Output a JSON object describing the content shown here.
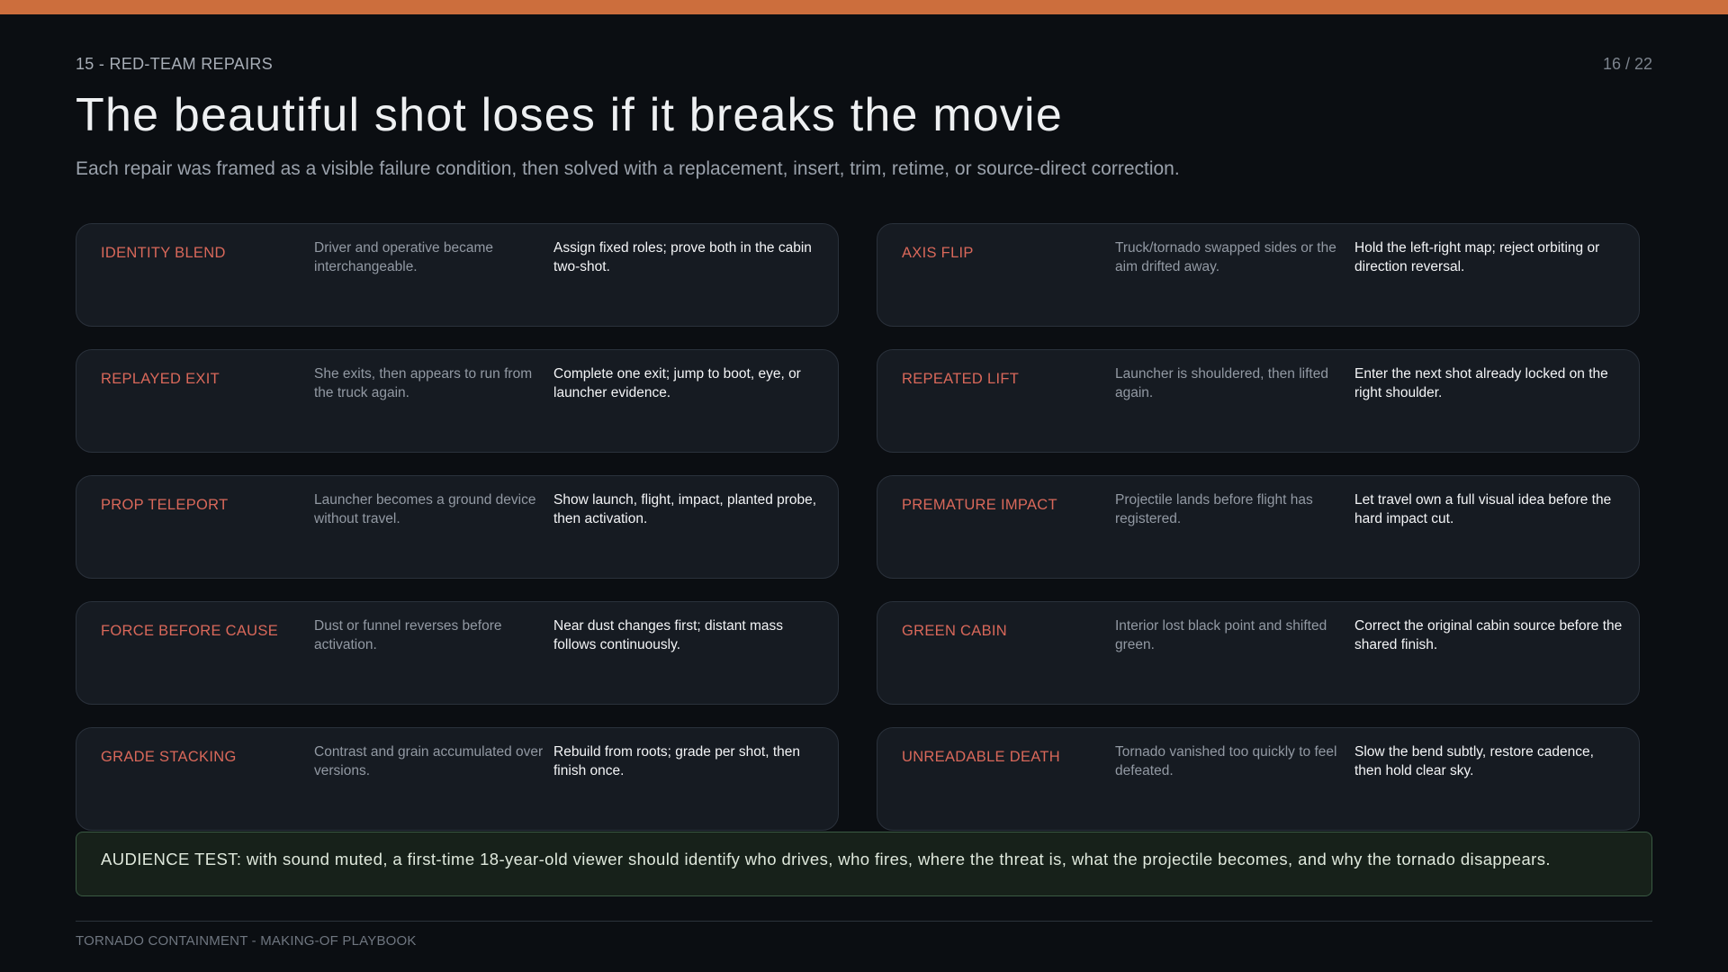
{
  "slide": {
    "section": "15 - RED-TEAM REPAIRS",
    "page_counter": "16 / 22",
    "title": "The beautiful shot loses if it breaks the movie",
    "subtitle": "Each repair was framed as a visible failure condition, then solved with a replacement, insert, trim, retime, or source-direct correction."
  },
  "repairs": [
    {
      "label": "IDENTITY BLEND",
      "problem": "Driver and operative became interchangeable.",
      "fix": "Assign fixed roles; prove both in the cabin two-shot."
    },
    {
      "label": "AXIS FLIP",
      "problem": "Truck/tornado swapped sides or the aim drifted away.",
      "fix": "Hold the left-right map; reject orbiting or direction reversal."
    },
    {
      "label": "REPLAYED EXIT",
      "problem": "She exits, then appears to run from the truck again.",
      "fix": "Complete one exit; jump to boot, eye, or launcher evidence."
    },
    {
      "label": "REPEATED LIFT",
      "problem": "Launcher is shouldered, then lifted again.",
      "fix": "Enter the next shot already locked on the right shoulder."
    },
    {
      "label": "PROP TELEPORT",
      "problem": "Launcher becomes a ground device without travel.",
      "fix": "Show launch, flight, impact, planted probe, then activation."
    },
    {
      "label": "PREMATURE IMPACT",
      "problem": "Projectile lands before flight has registered.",
      "fix": "Let travel own a full visual idea before the hard impact cut."
    },
    {
      "label": "FORCE BEFORE CAUSE",
      "problem": "Dust or funnel reverses before activation.",
      "fix": "Near dust changes first; distant mass follows continuously."
    },
    {
      "label": "GREEN CABIN",
      "problem": "Interior lost black point and shifted green.",
      "fix": "Correct the original cabin source before the shared finish."
    },
    {
      "label": "GRADE STACKING",
      "problem": "Contrast and grain accumulated over versions.",
      "fix": "Rebuild from roots; grade per shot, then finish once."
    },
    {
      "label": "UNREADABLE DEATH",
      "problem": "Tornado vanished too quickly to feel defeated.",
      "fix": "Slow the bend subtly, restore cadence, then hold clear sky."
    }
  ],
  "audience_test": "AUDIENCE TEST: with sound muted, a first-time 18-year-old viewer should identify who drives, who fires, where the threat is, what the projectile becomes, and why the tornado disappears.",
  "footer": "TORNADO CONTAINMENT - MAKING-OF PLAYBOOK",
  "colors": {
    "accent_bar": "#cc6e3d",
    "label_red": "#d9685a",
    "background": "#0b0e12",
    "card": "#161b22",
    "audience_bg": "#17211a",
    "audience_border": "#3a5a43"
  }
}
